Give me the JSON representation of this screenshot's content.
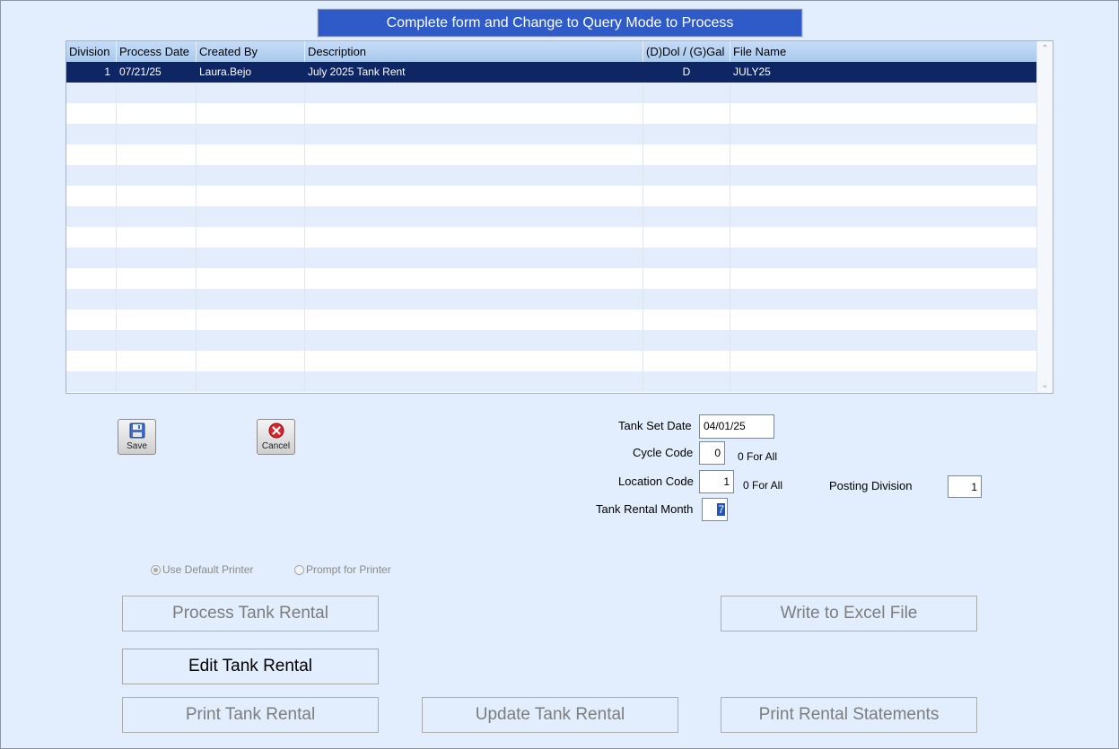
{
  "banner": "Complete form and Change to Query Mode to Process",
  "grid": {
    "columns": [
      "Division",
      "Process Date",
      "Created By",
      "Description",
      "(D)Dol / (G)Gal",
      "File Name"
    ],
    "rows": [
      {
        "division": "1",
        "process_date": "07/21/25",
        "created_by": "Laura.Bejo",
        "description": "July 2025 Tank Rent",
        "dol_gal": "D",
        "file_name": "JULY25"
      }
    ]
  },
  "toolbar": {
    "save_label": "Save",
    "cancel_label": "Cancel"
  },
  "form": {
    "tank_set_date_label": "Tank Set Date",
    "tank_set_date_value": "04/01/25",
    "cycle_code_label": "Cycle Code",
    "cycle_code_value": "0",
    "cycle_code_note": "0 For All",
    "location_code_label": "Location Code",
    "location_code_value": "1",
    "location_code_note": "0 For All",
    "posting_division_label": "Posting Division",
    "posting_division_value": "1",
    "tank_rental_month_label": "Tank Rental Month",
    "tank_rental_month_value": "7"
  },
  "printer": {
    "default_label": "Use Default Printer",
    "prompt_label": "Prompt for Printer"
  },
  "buttons": {
    "process": "Process Tank Rental",
    "write_excel": "Write to Excel File",
    "edit": "Edit Tank Rental",
    "print": "Print Tank Rental",
    "update": "Update Tank Rental",
    "print_statements": "Print Rental Statements"
  }
}
